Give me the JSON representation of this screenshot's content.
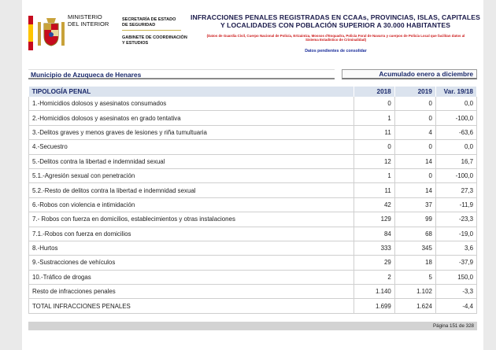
{
  "header": {
    "ministry": "MINISTERIO\nDEL INTERIOR",
    "secretaria": "SECRETARÍA DE ESTADO\nDE SEGURIDAD",
    "gabinete": "GABINETE DE COORDINACIÓN\nY ESTUDIOS",
    "title": "INFRACCIONES PENALES REGISTRADAS EN CCAAs, PROVINCIAS, ISLAS, CAPITALES Y LOCALIDADES CON POBLACIÓN SUPERIOR A 30.000 HABITANTES",
    "subtitle": "(Datos de Guardia Civil, Cuerpo Nacional de Policía, Ertzaintza, Mossos d'Esquadra, Policía Foral de Navarra y cuerpos de Policía Local que facilitan datos al Sistema Estadístico de Criminalidad)",
    "note": "Datos pendientes de consolidar"
  },
  "municipio": "Municipio de Azuqueca de Henares",
  "periodo": "Acumulado enero a diciembre",
  "table": {
    "headers": [
      "TIPOLOGÍA PENAL",
      "2018",
      "2019",
      "Var. 19/18"
    ],
    "rows": [
      [
        "1.-Homicidios dolosos y asesinatos consumados",
        "0",
        "0",
        "0,0"
      ],
      [
        "2.-Homicidios dolosos y asesinatos en grado tentativa",
        "1",
        "0",
        "-100,0"
      ],
      [
        "3.-Delitos graves y menos graves de lesiones y riña tumultuaria",
        "11",
        "4",
        "-63,6"
      ],
      [
        "4.-Secuestro",
        "0",
        "0",
        "0,0"
      ],
      [
        "5.-Delitos contra la libertad e indemnidad sexual",
        "12",
        "14",
        "16,7"
      ],
      [
        "5.1.-Agresión sexual con penetración",
        "1",
        "0",
        "-100,0"
      ],
      [
        "5.2.-Resto de delitos contra la libertad e indemnidad sexual",
        "11",
        "14",
        "27,3"
      ],
      [
        "6.-Robos con violencia e intimidación",
        "42",
        "37",
        "-11,9"
      ],
      [
        "7.- Robos con fuerza en domicilios, establecimientos y otras instalaciones",
        "129",
        "99",
        "-23,3"
      ],
      [
        "7.1.-Robos con fuerza en domicilios",
        "84",
        "68",
        "-19,0"
      ],
      [
        "8.-Hurtos",
        "333",
        "345",
        "3,6"
      ],
      [
        "9.-Sustracciones de vehículos",
        "29",
        "18",
        "-37,9"
      ],
      [
        "10.-Tráfico de drogas",
        "2",
        "5",
        "150,0"
      ],
      [
        "Resto de infracciones penales",
        "1.140",
        "1.102",
        "-3,3"
      ],
      [
        "TOTAL INFRACCIONES PENALES",
        "1.699",
        "1.624",
        "-4,4"
      ]
    ]
  },
  "footer": {
    "page": "Página 151 de  328"
  },
  "colors": {
    "header_fill": "#dbe3ee",
    "header_text": "#1b2a6b",
    "subtitle_red": "#cc1a1a"
  }
}
